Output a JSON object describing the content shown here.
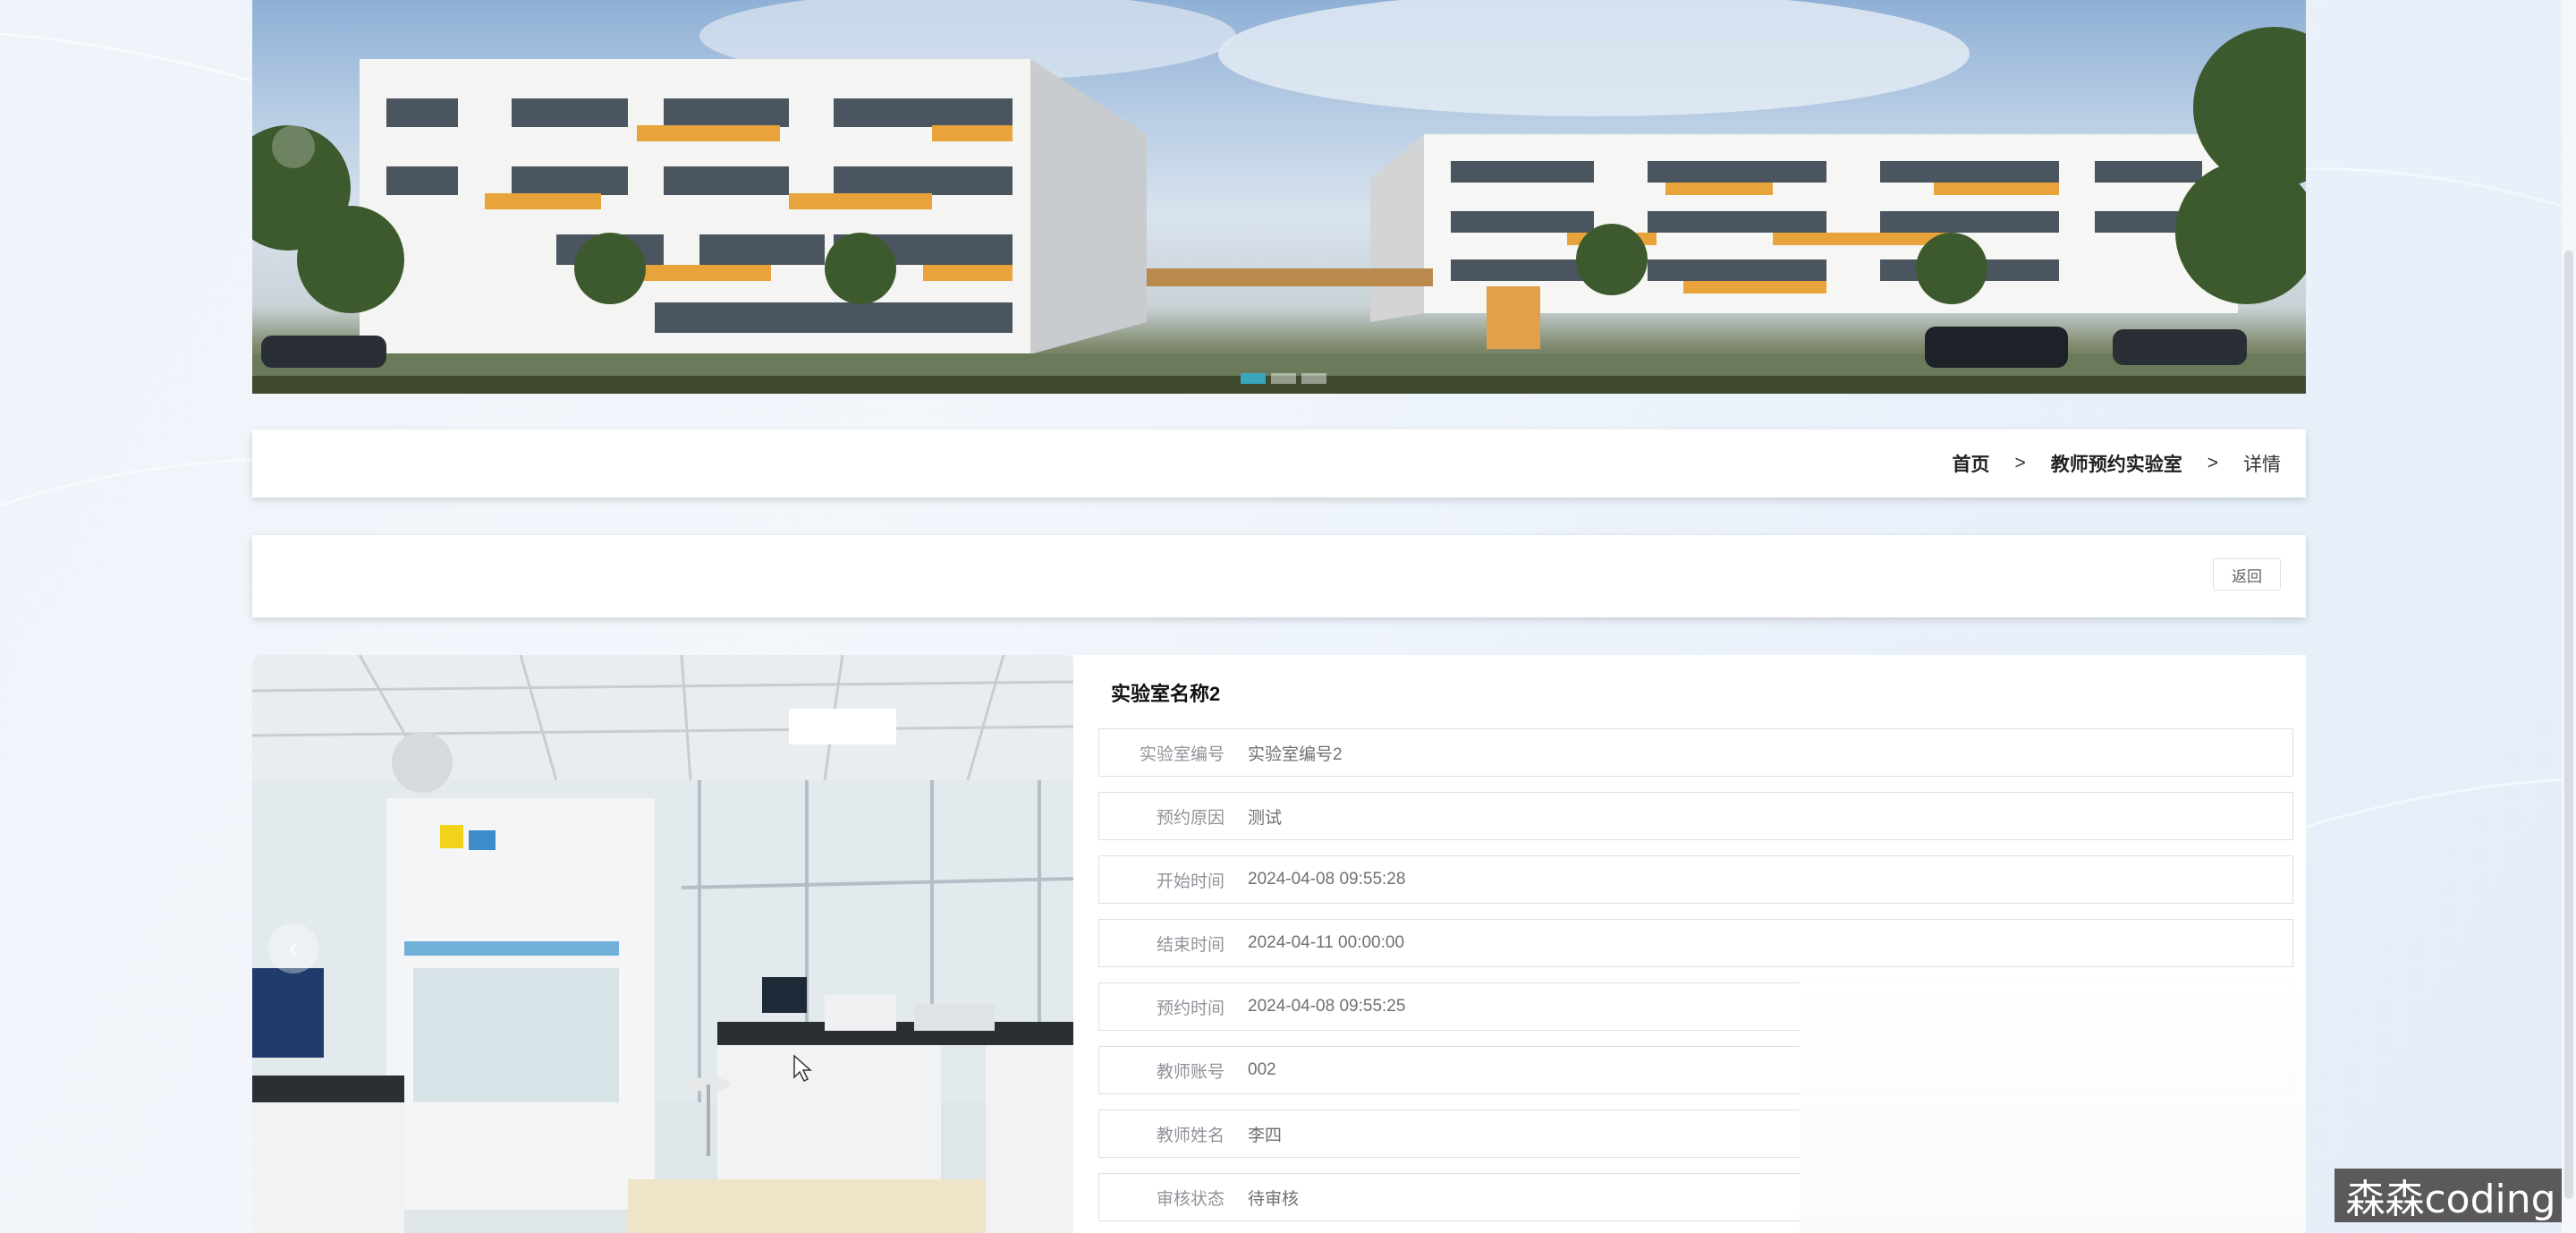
{
  "breadcrumb": {
    "home": "首页",
    "section": "教师预约实验室",
    "current": "详情",
    "separator": ">"
  },
  "actions": {
    "back_label": "返回"
  },
  "detail": {
    "title": "实验室名称2",
    "fields": [
      {
        "label": "实验室编号",
        "value": "实验室编号2"
      },
      {
        "label": "预约原因",
        "value": "测试"
      },
      {
        "label": "开始时间",
        "value": "2024-04-08 09:55:28"
      },
      {
        "label": "结束时间",
        "value": "2024-04-11 00:00:00"
      },
      {
        "label": "预约时间",
        "value": "2024-04-08 09:55:25"
      },
      {
        "label": "教师账号",
        "value": "002"
      },
      {
        "label": "教师姓名",
        "value": "李四"
      },
      {
        "label": "审核状态",
        "value": "待审核"
      }
    ]
  },
  "banner": {
    "slide_count": 3,
    "active_slide": 1
  },
  "watermark": "森森coding",
  "colors": {
    "accent": "#3aa6b9",
    "panel": "#ffffff",
    "label": "#909399",
    "value": "#707070"
  }
}
